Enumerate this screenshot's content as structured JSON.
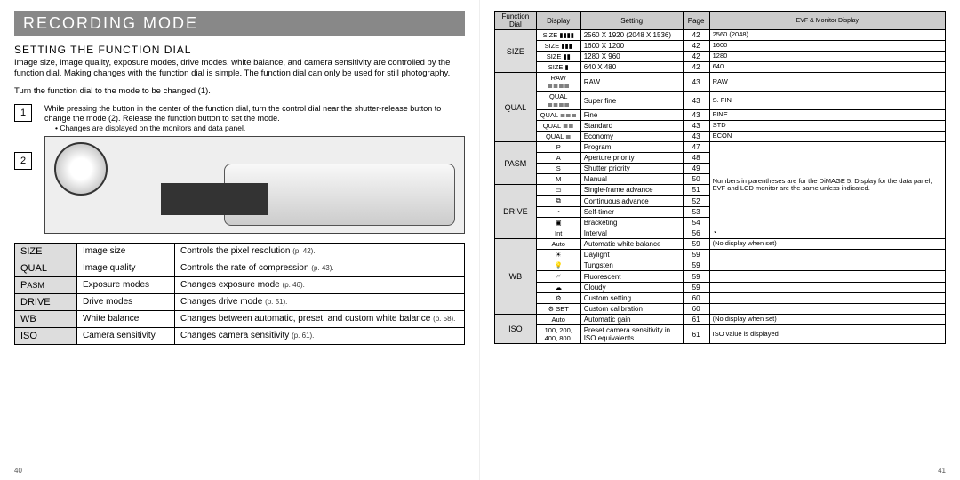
{
  "title": "RECORDING MODE",
  "left": {
    "heading": "SETTING THE FUNCTION DIAL",
    "intro": "Image size, image quality, exposure modes, drive modes, white balance, and camera sensitivity are controlled by the function dial. Making changes with the function dial is simple. The function dial can only be used for still photography.",
    "step1": "Turn the function dial to the mode to be changed (1).",
    "step2": "While pressing the button in the center of the function dial, turn the control dial near the shutter-release button to change the mode (2). Release the function button to set the mode.",
    "bullet": "• Changes are displayed on the monitors and data panel.",
    "marker1": "1",
    "marker2": "2",
    "rows": [
      {
        "label": "SIZE",
        "name": "Image size",
        "desc": "Controls the pixel resolution ",
        "pref": "(p. 42)"
      },
      {
        "label": "QUAL",
        "name": "Image quality",
        "desc": "Controls the rate of compression ",
        "pref": "(p. 43)"
      },
      {
        "label": "PASM",
        "name": "Exposure modes",
        "desc": "Changes exposure mode ",
        "pref": "(p. 46)"
      },
      {
        "label": "DRIVE",
        "name": "Drive modes",
        "desc": "Changes drive mode ",
        "pref": "(p. 51)"
      },
      {
        "label": "WB",
        "name": "White balance",
        "desc": "Changes between automatic, preset, and custom white balance ",
        "pref": "(p. 58)"
      },
      {
        "label": "ISO",
        "name": "Camera sensitivity",
        "desc": "Changes camera sensitivity ",
        "pref": "(p. 61)"
      }
    ],
    "page_num": "40"
  },
  "right": {
    "headers": {
      "fd": "Function Dial",
      "disp": "Display",
      "set": "Setting",
      "page": "Page",
      "evf": "EVF & Monitor Display"
    },
    "groups": [
      {
        "label": "SIZE",
        "rows": [
          {
            "disp": "SIZE ▮▮▮▮",
            "set": "2560 X 1920 (2048 X 1536)",
            "page": "42",
            "evf": "2560 (2048)"
          },
          {
            "disp": "SIZE ▮▮▮",
            "set": "1600 X 1200",
            "page": "42",
            "evf": "1600"
          },
          {
            "disp": "SIZE ▮▮",
            "set": "1280 X 960",
            "page": "42",
            "evf": "1280"
          },
          {
            "disp": "SIZE ▮",
            "set": "640 X 480",
            "page": "42",
            "evf": "640"
          }
        ]
      },
      {
        "label": "QUAL",
        "rows": [
          {
            "disp": "RAW ≣≣≣≣",
            "set": "RAW",
            "page": "43",
            "evf": "RAW"
          },
          {
            "disp": "QUAL ≣≣≣≣",
            "set": "Super fine",
            "page": "43",
            "evf": "S. FIN"
          },
          {
            "disp": "QUAL ≣≣≣",
            "set": "Fine",
            "page": "43",
            "evf": "FINE"
          },
          {
            "disp": "QUAL ≣≣",
            "set": "Standard",
            "page": "43",
            "evf": "STD"
          },
          {
            "disp": "QUAL ≣",
            "set": "Economy",
            "page": "43",
            "evf": "ECON"
          }
        ]
      },
      {
        "label": "PASM",
        "rows": [
          {
            "disp": "P",
            "set": "Program",
            "page": "47",
            "evf": null
          },
          {
            "disp": "A",
            "set": "Aperture priority",
            "page": "48",
            "evf": null
          },
          {
            "disp": "S",
            "set": "Shutter priority",
            "page": "49",
            "evf": null
          },
          {
            "disp": "M",
            "set": "Manual",
            "page": "50",
            "evf": null
          }
        ],
        "note": "Numbers in parentheses are for the DiMAGE 5. Display for the data panel, EVF and LCD monitor are the same unless indicated."
      },
      {
        "label": "DRIVE",
        "rows": [
          {
            "disp": "▭",
            "set": "Single-frame advance",
            "page": "51",
            "evf": null
          },
          {
            "disp": "⧉",
            "set": "Continuous advance",
            "page": "52",
            "evf": null
          },
          {
            "disp": "◔",
            "set": "Self-timer",
            "page": "53",
            "evf": null
          },
          {
            "disp": "▣",
            "set": "Bracketing",
            "page": "54",
            "evf": null
          },
          {
            "disp": "Int",
            "set": "Interval",
            "page": "56",
            "evf": "◔"
          }
        ]
      },
      {
        "label": "WB",
        "rows": [
          {
            "disp": "Auto",
            "set": "Automatic white balance",
            "page": "59",
            "evf": "(No display when set)"
          },
          {
            "disp": "☀",
            "set": "Daylight",
            "page": "59",
            "evf": ""
          },
          {
            "disp": "💡",
            "set": "Tungsten",
            "page": "59",
            "evf": ""
          },
          {
            "disp": "🗲",
            "set": "Fluorescent",
            "page": "59",
            "evf": ""
          },
          {
            "disp": "☁",
            "set": "Cloudy",
            "page": "59",
            "evf": ""
          },
          {
            "disp": "⚙",
            "set": "Custom setting",
            "page": "60",
            "evf": ""
          },
          {
            "disp": "⚙ SET",
            "set": "Custom calibration",
            "page": "60",
            "evf": ""
          }
        ]
      },
      {
        "label": "ISO",
        "rows": [
          {
            "disp": "Auto",
            "set": "Automatic gain",
            "page": "61",
            "evf": "(No display when set)"
          },
          {
            "disp": "100, 200, 400, 800.",
            "set": "Preset camera sensitivity in ISO equivalents.",
            "page": "61",
            "evf": "ISO value is displayed"
          }
        ]
      }
    ],
    "page_num": "41"
  }
}
